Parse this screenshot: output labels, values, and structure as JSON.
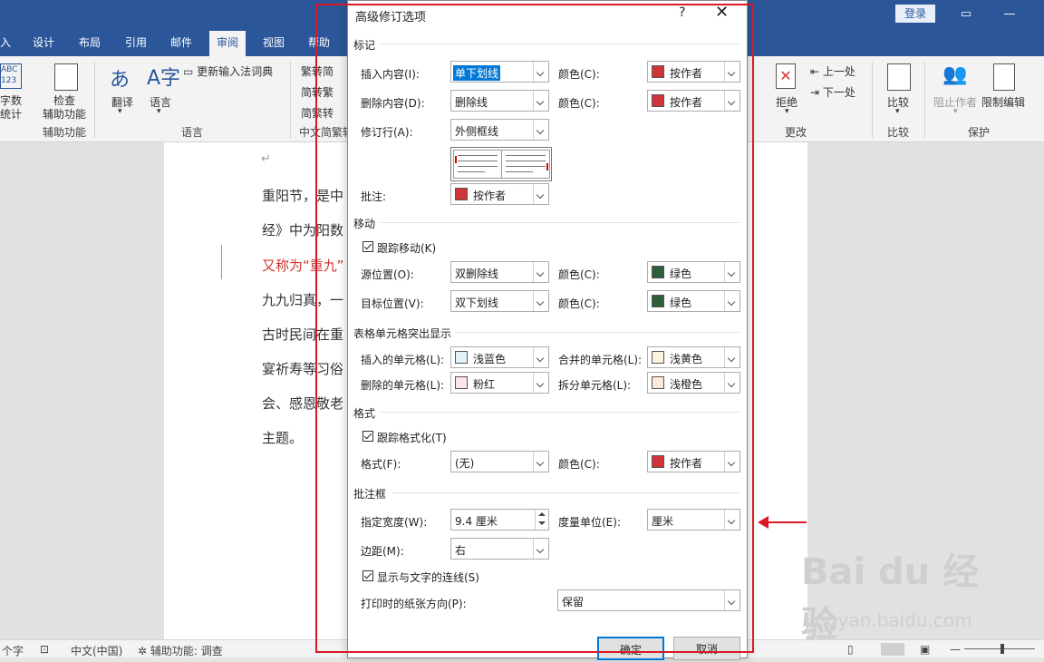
{
  "titlebar": {
    "login": "登录"
  },
  "tabs": [
    "入",
    "设计",
    "布局",
    "引用",
    "邮件",
    "审阅",
    "视图",
    "帮助"
  ],
  "active_tab": "审阅",
  "ribbon": {
    "word_count_icon": "ABC\n123",
    "word_count": "字数\n统计",
    "check_access": "检查\n辅助功能",
    "group_access": "辅助功能",
    "translate": "翻译",
    "language": "语言",
    "group_language": "语言",
    "update_ime": "更新输入法词典",
    "trad_simp_1": "繁转简",
    "trad_simp_2": "简转繁",
    "trad_simp_3": "简繁转",
    "group_chinese": "中文简繁转",
    "reject": "拒绝",
    "prev": "上一处",
    "next": "下一处",
    "group_changes": "更改",
    "compare": "比较",
    "group_compare": "比较",
    "block_authors": "阻止作者",
    "restrict": "限制编辑",
    "group_protect": "保护"
  },
  "document": {
    "lines": [
      "重阳节，是中",
      "经》中为阳数",
      "又称为“重九”",
      "九九归真，一",
      "古时民间在重",
      "宴祈寿等习俗",
      "会、感恩敬老",
      "主题。"
    ]
  },
  "statusbar": {
    "words": "个字",
    "lang": "中文(中国)",
    "access": "辅助功能: 调查"
  },
  "dialog": {
    "title": "高级修订选项",
    "help": "?",
    "close": "✕",
    "sections": {
      "markup": "标记",
      "moves": "移动",
      "table": "表格单元格突出显示",
      "formatting": "格式",
      "balloons": "批注框"
    },
    "insertions_label": "插入内容(I):",
    "insertions_value": "单下划线",
    "insertions_color_label": "颜色(C):",
    "insertions_color": "按作者",
    "deletions_label": "删除内容(D):",
    "deletions_value": "删除线",
    "deletions_color_label": "颜色(C):",
    "deletions_color": "按作者",
    "changed_lines_label": "修订行(A):",
    "changed_lines_value": "外侧框线",
    "comments_label": "批注:",
    "comments_value": "按作者",
    "track_moves": "跟踪移动(K)",
    "moved_from_label": "源位置(O):",
    "moved_from_value": "双删除线",
    "moved_from_color_label": "颜色(C):",
    "moved_from_color": "绿色",
    "moved_to_label": "目标位置(V):",
    "moved_to_value": "双下划线",
    "moved_to_color_label": "颜色(C):",
    "moved_to_color": "绿色",
    "inserted_cells_label": "插入的单元格(L):",
    "inserted_cells_value": "浅蓝色",
    "merged_cells_label": "合并的单元格(L):",
    "merged_cells_value": "浅黄色",
    "deleted_cells_label": "删除的单元格(L):",
    "deleted_cells_value": "粉红",
    "split_cells_label": "拆分单元格(L):",
    "split_cells_value": "浅橙色",
    "track_formatting": "跟踪格式化(T)",
    "format_label": "格式(F):",
    "format_value": "(无)",
    "format_color_label": "颜色(C):",
    "format_color": "按作者",
    "width_label": "指定宽度(W):",
    "width_value": "9.4 厘米",
    "unit_label": "度量单位(E):",
    "unit_value": "厘米",
    "margin_label": "边距(M):",
    "margin_value": "右",
    "show_lines": "显示与文字的连线(S)",
    "paper_label": "打印时的纸张方向(P):",
    "paper_value": "保留",
    "ok": "确定",
    "cancel": "取消"
  },
  "colors": {
    "red": "#d13438",
    "green": "#2e5e3a",
    "light_blue": "#e3f1fb",
    "light_yellow": "#fdf3dc",
    "pink": "#fbe3f0",
    "light_orange": "#fde8dc",
    "accent": "#2b579a",
    "annotation": "#d81a26"
  },
  "watermark": {
    "main": "Bai du 经验",
    "sub": "jingyan.baidu.com"
  }
}
